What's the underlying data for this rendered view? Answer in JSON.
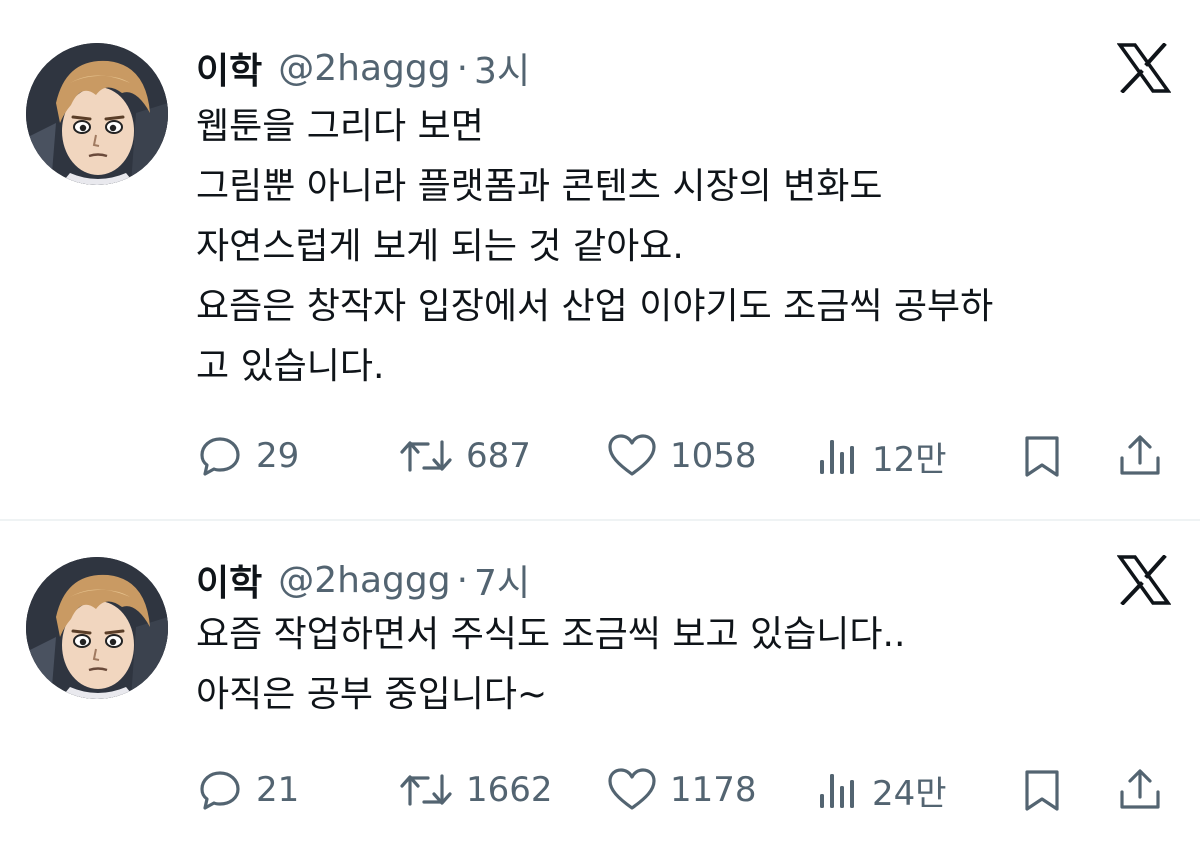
{
  "colors": {
    "text_primary": "#0f1419",
    "text_secondary": "#536471",
    "divider": "#eff3f4",
    "background": "#ffffff"
  },
  "tweets": [
    {
      "author": {
        "name": "이학",
        "handle": "@2haggg",
        "separator": "·",
        "time": "3시",
        "avatar_icon": "manga-character-avatar"
      },
      "lines": [
        "웹툰을 그리다 보면",
        "그림뿐 아니라 플랫폼과 콘텐츠 시장의 변화도",
        "자연스럽게 보게 되는 것 같아요.",
        "요즘은 창작자 입장에서 산업 이야기도 조금씩 공부하",
        "고 있습니다."
      ],
      "stats": {
        "replies": "29",
        "retweets": "687",
        "likes": "1058",
        "views": "12만"
      }
    },
    {
      "author": {
        "name": "이학",
        "handle": "@2haggg",
        "separator": "·",
        "time": "7시",
        "avatar_icon": "manga-character-avatar"
      },
      "lines": [
        "요즘 작업하면서 주식도 조금씩 보고 있습니다..",
        "아직은 공부 중입니다~"
      ],
      "stats": {
        "replies": "21",
        "retweets": "1662",
        "likes": "1178",
        "views": "24만"
      }
    }
  ],
  "icons": {
    "reply": "reply-icon",
    "retweet": "retweet-icon",
    "like": "heart-icon",
    "views": "views-icon",
    "bookmark": "bookmark-icon",
    "share": "share-icon",
    "brand": "x-logo-icon"
  }
}
